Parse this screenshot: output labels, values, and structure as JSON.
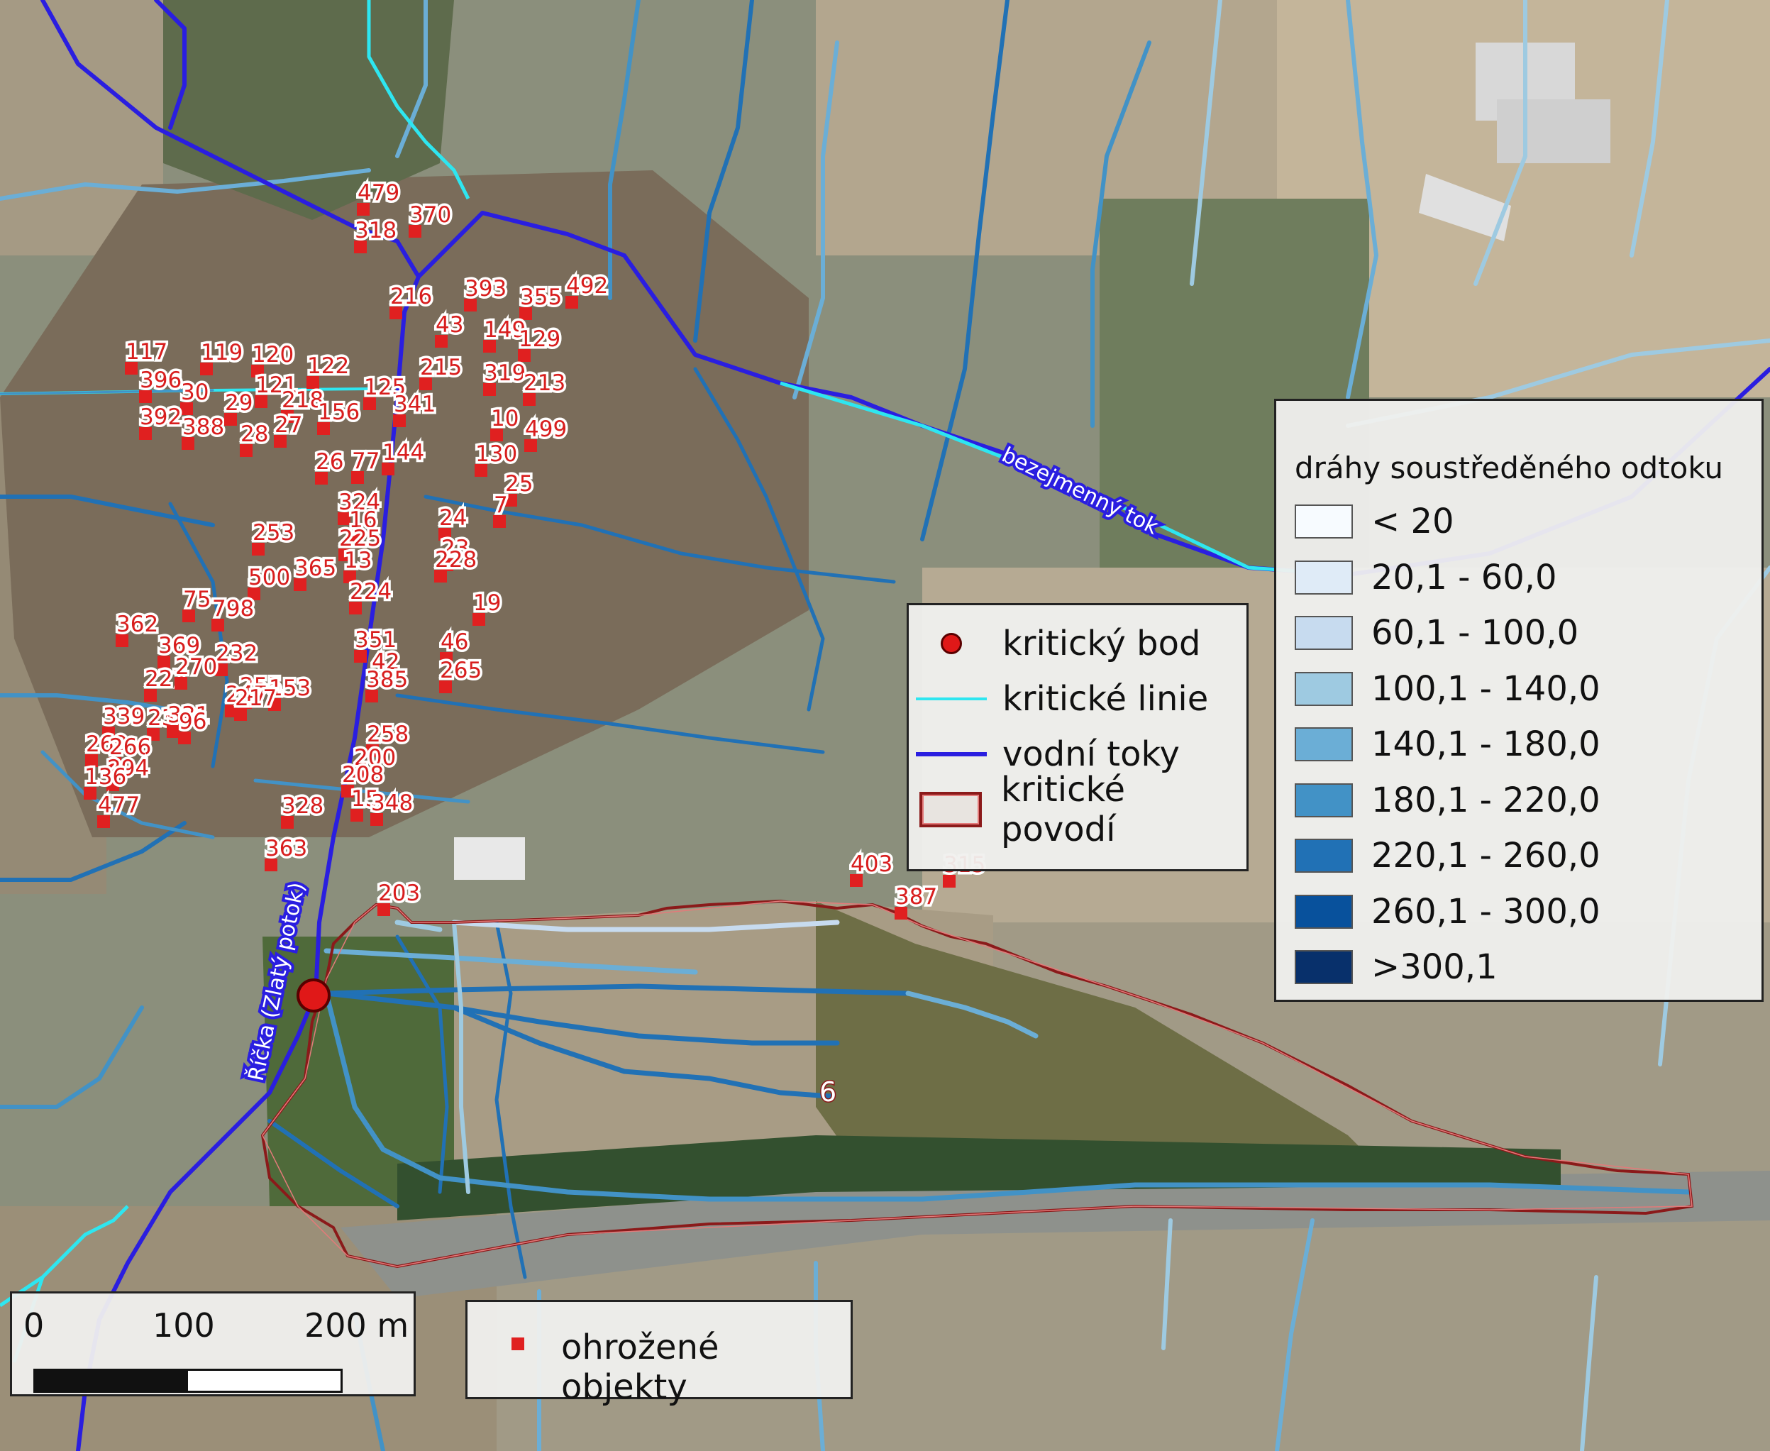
{
  "map": {
    "stream_labels": [
      "bezejmenný tok",
      "Říčka (Zlatý potok)"
    ],
    "catchment_label": "6",
    "objects": [
      "479",
      "370",
      "318",
      "216",
      "393",
      "355",
      "492",
      "43",
      "149",
      "129",
      "117",
      "119",
      "120",
      "122",
      "396",
      "30",
      "121",
      "218",
      "156",
      "125",
      "215",
      "319",
      "213",
      "392",
      "388",
      "29",
      "28",
      "27",
      "341",
      "10",
      "499",
      "26",
      "77",
      "144",
      "130",
      "25",
      "7",
      "324",
      "16",
      "24",
      "253",
      "225",
      "13",
      "23",
      "500",
      "365",
      "224",
      "228",
      "19",
      "75",
      "798",
      "362",
      "369",
      "232",
      "351",
      "42",
      "227",
      "270",
      "255",
      "153",
      "385",
      "46",
      "247",
      "217",
      "265",
      "339",
      "239",
      "331",
      "96",
      "258",
      "269",
      "266",
      "294",
      "200",
      "208",
      "15",
      "136",
      "477",
      "328",
      "348",
      "363",
      "203",
      "403",
      "315",
      "387"
    ]
  },
  "legend_main": {
    "title": "dráhy soustředěného odtoku",
    "classes": [
      {
        "label": "< 20",
        "color": "#f7fbff"
      },
      {
        "label": "20,1 - 60,0",
        "color": "#dfebf7"
      },
      {
        "label": "60,1 - 100,0",
        "color": "#c7dbef"
      },
      {
        "label": "100,1 - 140,0",
        "color": "#9ecae1"
      },
      {
        "label": "140,1 - 180,0",
        "color": "#6baed6"
      },
      {
        "label": "180,1 - 220,0",
        "color": "#4292c6"
      },
      {
        "label": "220,1 - 260,0",
        "color": "#2171b5"
      },
      {
        "label": "260,1 - 300,0",
        "color": "#08519c"
      },
      {
        "label": ">300,1",
        "color": "#08306b"
      }
    ]
  },
  "legend_features": {
    "critical_point": "kritický bod",
    "critical_lines": "kritické linie",
    "streams": "vodní toky",
    "critical_catchment": "kritické povodí"
  },
  "legend_objects": {
    "label": "ohrožené objekty"
  },
  "scalebar": {
    "labels": [
      "0",
      "100",
      "200 m"
    ]
  },
  "colors": {
    "stream": "#2a1ee0",
    "critical_line": "#2ee6f0",
    "catchment": "#8b1a1a",
    "object": "#e02020",
    "critical_point": "#e01818"
  }
}
